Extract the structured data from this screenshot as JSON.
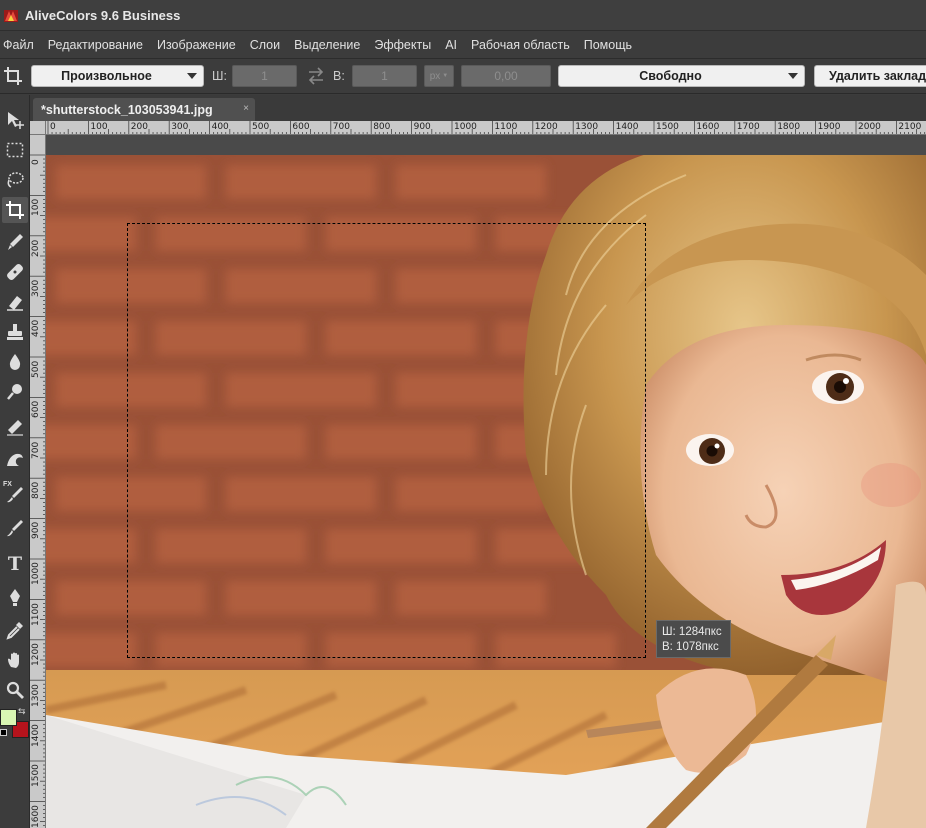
{
  "window": {
    "title": "AliveColors 9.6 Business"
  },
  "menu": {
    "items": [
      "Файл",
      "Редактирование",
      "Изображение",
      "Слои",
      "Выделение",
      "Эффекты",
      "AI",
      "Рабочая область",
      "Помощь"
    ]
  },
  "options": {
    "ratio_mode": "Произвольное",
    "width_label": "Ш:",
    "width_value": "1",
    "height_label": "В:",
    "height_value": "1",
    "unit": "px",
    "resolution_value": "0,00",
    "constraint_mode": "Свободно",
    "delete_bookmark_label": "Удалить закладку"
  },
  "document": {
    "tab_title": "*shutterstock_103053941.jpg",
    "close_glyph": "×"
  },
  "ruler": {
    "top_labels": [
      "0",
      "100",
      "200",
      "300",
      "400",
      "500",
      "600",
      "700",
      "800",
      "900",
      "1000",
      "1100",
      "1200",
      "1300",
      "1400",
      "1500",
      "1600",
      "1700",
      "1800",
      "1900",
      "2000",
      "2100"
    ],
    "left_labels": [
      "0",
      "100",
      "200",
      "300",
      "400",
      "500",
      "600",
      "700",
      "800",
      "900",
      "1000",
      "1100",
      "1200",
      "1300",
      "1400",
      "1500",
      "1600"
    ]
  },
  "selection_tooltip": {
    "width_text": "Ш:  1284пкс",
    "height_text": "В:  1078пкс"
  },
  "tools": [
    "move-tool",
    "rect-select-tool",
    "lasso-tool",
    "crop-tool",
    "brush-tool",
    "healing-tool",
    "eraser-tool",
    "stamp-tool",
    "blur-tool",
    "dodge-tool",
    "smudge-tool",
    "liquify-tool",
    "fx-brush-tool",
    "paint-brush-tool",
    "text-tool",
    "pen-tool",
    "eyedropper-tool",
    "hand-tool",
    "zoom-tool"
  ],
  "text_tool_glyph": "T",
  "fx_glyph": "FX",
  "colors": {
    "foreground": "#d9f7b3",
    "background": "#b5131c"
  }
}
